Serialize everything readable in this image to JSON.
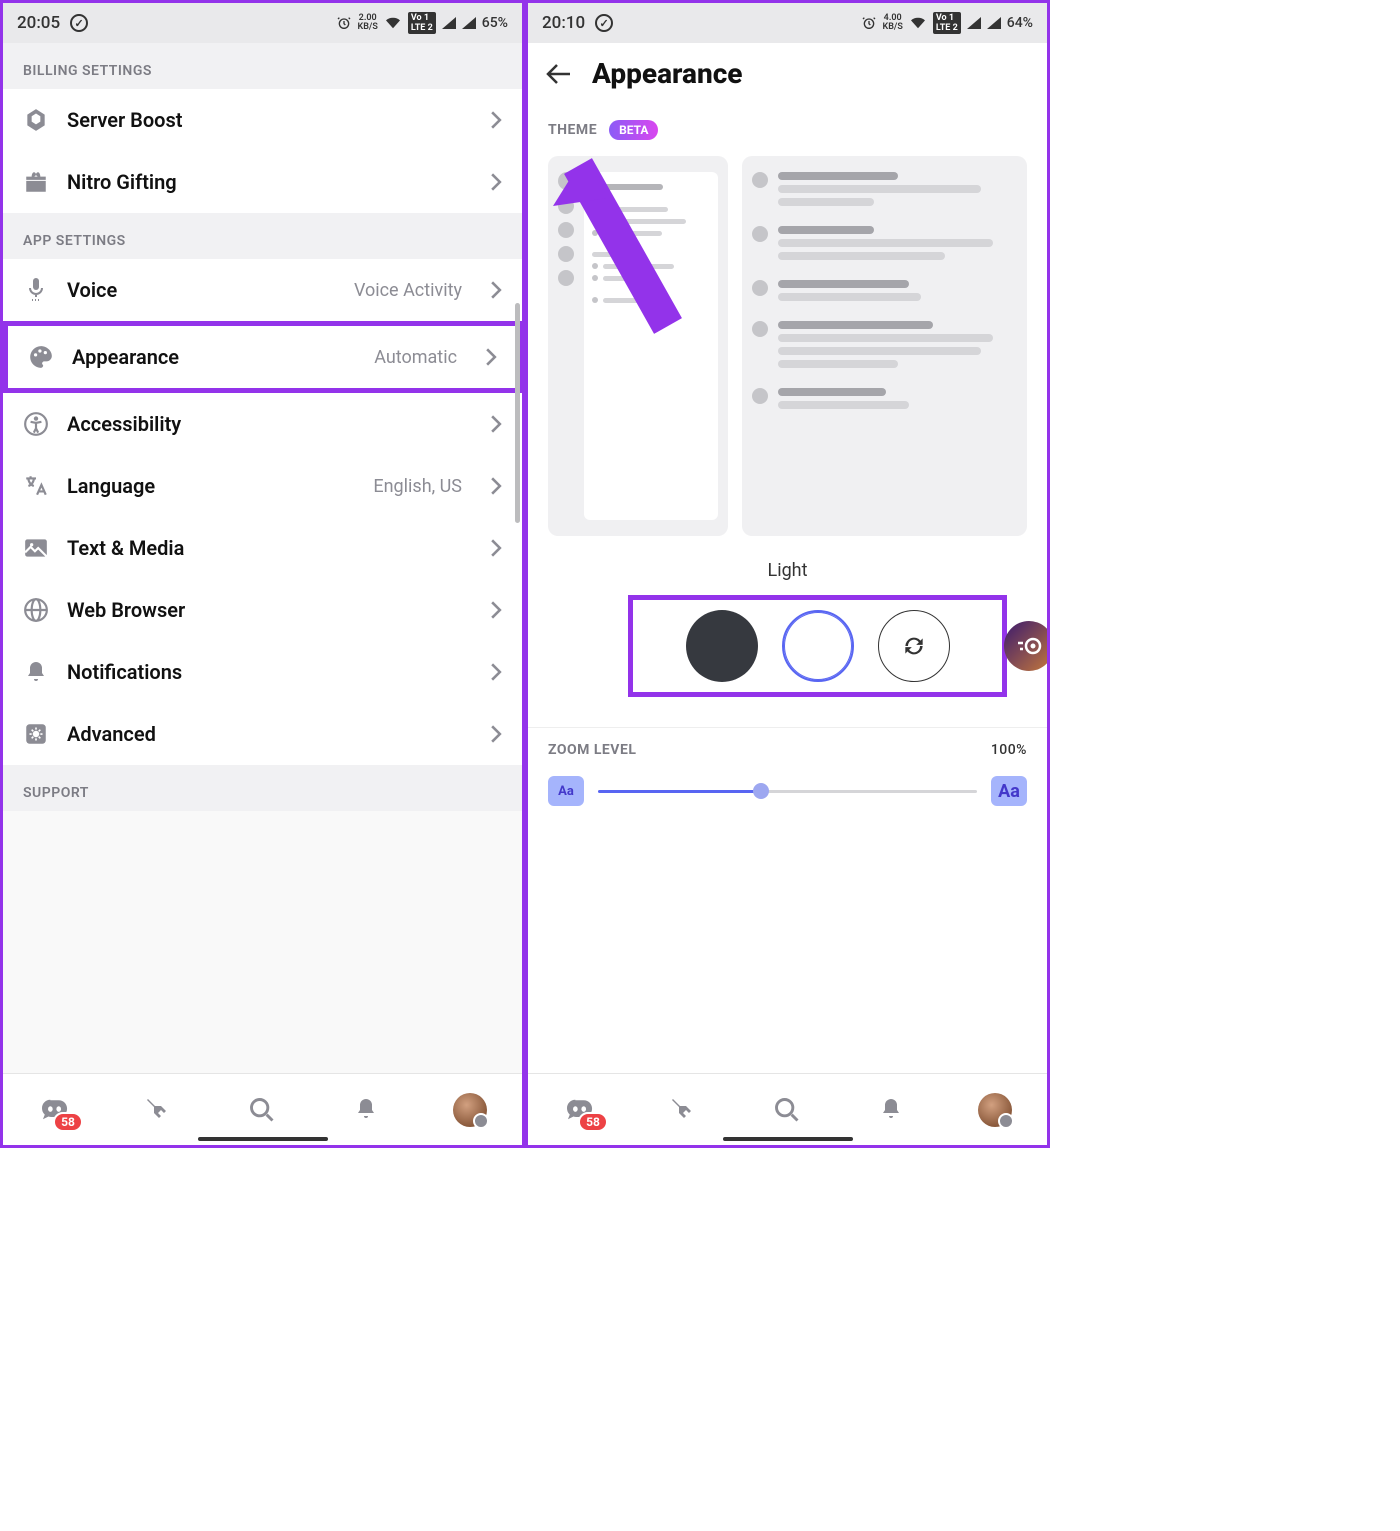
{
  "left": {
    "status": {
      "time": "20:05",
      "kbs_top": "2.00",
      "kbs_bot": "KB/S",
      "vo": "Vo 1",
      "lte": "LTE 2",
      "battery": "65%"
    },
    "sections": {
      "billing": "BILLING SETTINGS",
      "app": "APP SETTINGS",
      "support": "SUPPORT"
    },
    "rows": {
      "server_boost": "Server Boost",
      "nitro_gifting": "Nitro Gifting",
      "voice": "Voice",
      "voice_val": "Voice Activity",
      "appearance": "Appearance",
      "appearance_val": "Automatic",
      "accessibility": "Accessibility",
      "language": "Language",
      "language_val": "English, US",
      "text_media": "Text & Media",
      "web_browser": "Web Browser",
      "notifications": "Notifications",
      "advanced": "Advanced"
    },
    "nav": {
      "badge": "58"
    }
  },
  "right": {
    "status": {
      "time": "20:10",
      "kbs_top": "4.00",
      "kbs_bot": "KB/S",
      "vo": "Vo 1",
      "lte": "LTE 2",
      "battery": "64%"
    },
    "title": "Appearance",
    "theme_header": "THEME",
    "beta": "BETA",
    "selected_theme": "Light",
    "zoom_header": "ZOOM LEVEL",
    "zoom_value": "100%",
    "aa_small": "Aa",
    "aa_big": "Aa",
    "nav": {
      "badge": "58"
    }
  }
}
